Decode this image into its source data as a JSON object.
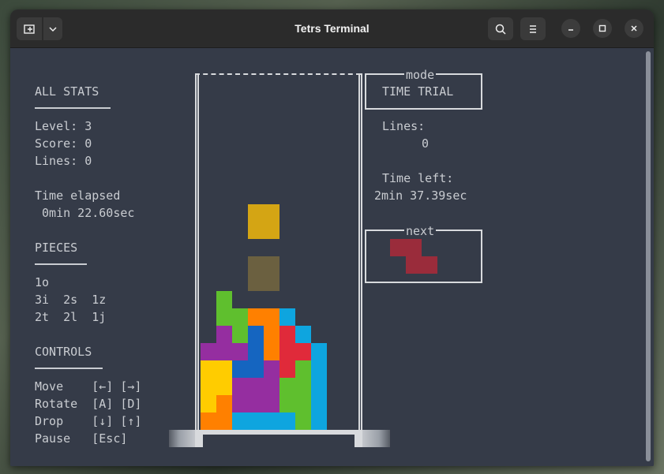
{
  "window": {
    "title": "Tetrs Terminal"
  },
  "stats": {
    "heading": "ALL STATS",
    "level": "Level: 3",
    "score": "Score: 0",
    "lines": "Lines: 0",
    "time_label": "Time elapsed",
    "time_value": " 0min 22.60sec"
  },
  "pieces": {
    "heading": "PIECES",
    "row1": "1o",
    "row2": "3i  2s  1z",
    "row3": "2t  2l  1j"
  },
  "controls": {
    "heading": "CONTROLS",
    "move": "Move    [←] [→]",
    "rotate": "Rotate  [A] [D]",
    "drop": "Drop    [↓] [↑]",
    "pause": "Pause   [Esc]"
  },
  "mode": {
    "label": "mode",
    "value": "TIME TRIAL",
    "lines_label": "Lines:",
    "lines_value": "0",
    "time_left_label": "Time left:",
    "time_left_value": "2min 37.39sec",
    "next_label": "next"
  },
  "colors": {
    "o": "#d4a514",
    "ghost": "#6b6040",
    "i": "#0ea5df",
    "s": "#5fbf2e",
    "z": "#e02a3a",
    "t": "#952ea0",
    "l": "#ff8000",
    "j": "#1565c0",
    "y": "#ffcc00",
    "next_z": "#9a2c3b"
  },
  "board": {
    "falling_piece": "o",
    "cells": [
      "........",
      "........",
      "........",
      "........",
      "........",
      "........",
      "........",
      "........",
      "...YY...",
      "...YY...",
      "........",
      "...GG...",
      "...GG...",
      ".S......",
      ".SSLLI..",
      ".TSJLZI.",
      "TTTJLZZI",
      "yyJJTZSI",
      "yyTTTSSI",
      "yLTTTSSI",
      "LLIIIISI"
    ]
  },
  "next_piece": "z"
}
